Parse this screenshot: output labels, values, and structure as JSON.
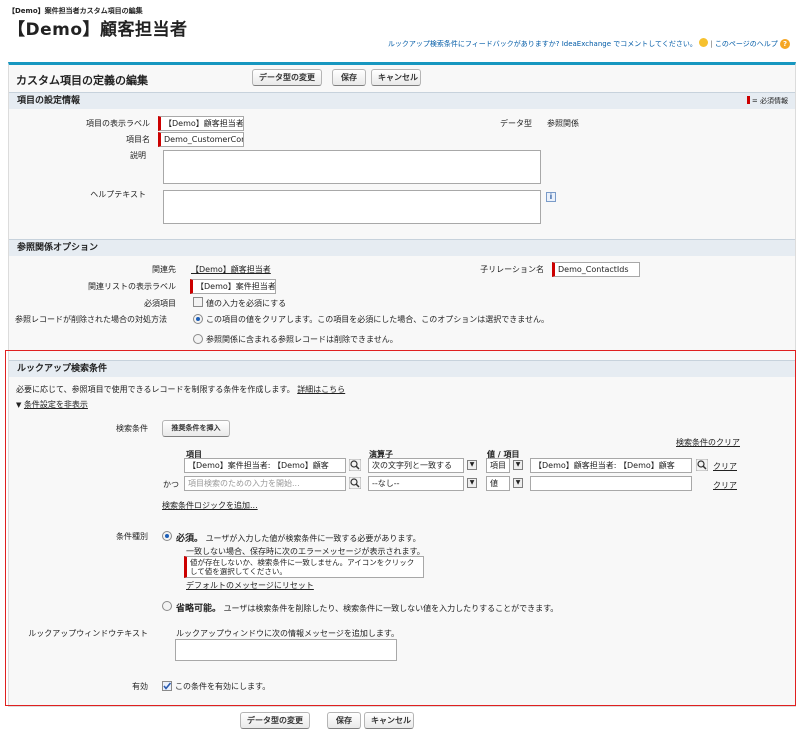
{
  "page": {
    "breadcrumb": "【Demo】案件担当者カスタム項目の編集",
    "title": "【Demo】顧客担当者",
    "feedback_text": "ルックアップ検索条件にフィードバックがありますか? IdeaExchange でコメントしてください。",
    "help_text": "このページのヘルプ",
    "separator": "|"
  },
  "editor": {
    "heading": "カスタム項目の定義の編集",
    "change_type_label": "データ型の変更",
    "save_label": "保存",
    "cancel_label": "キャンセル"
  },
  "field_settings": {
    "heading": "項目の設定情報",
    "required_legend": "= 必須情報",
    "display_label_label": "項目の表示ラベル",
    "display_label_value": "【Demo】顧客担当者",
    "field_name_label": "項目名",
    "field_name_value": "Demo_CustomerCor",
    "datatype_label": "データ型",
    "datatype_value": "参照関係",
    "description_label": "説明",
    "helptext_label": "ヘルプテキスト",
    "info_icon": "i"
  },
  "lookup_options": {
    "heading": "参照関係オプション",
    "related_to_label": "関連先",
    "related_to_value": "【Demo】顧客担当者",
    "child_rel_label": "子リレーション名",
    "child_rel_value": "Demo_ContactIds",
    "related_list_label": "関連リストの表示ラベル",
    "related_list_value": "【Demo】案件担当者",
    "required_label": "必須項目",
    "required_text": "値の入力を必須にする",
    "delete_label": "参照レコードが削除された場合の対処方法",
    "delete_opt1": "この項目の値をクリアします。この項目を必須にした場合、このオプションは選択できません。",
    "delete_opt2": "参照関係に含まれる参照レコードは削除できません。"
  },
  "lookup_filter": {
    "heading": "ルックアップ検索条件",
    "intro": "必要に応じて、参照項目で使用できるレコードを制限する条件を作成します。",
    "details_link": "詳細はこちら",
    "toggle_link": "条件設定を非表示",
    "criteria_label": "検索条件",
    "insert_button": "推奨条件を挿入",
    "clear_all_link": "検索条件のクリア",
    "col_field": "項目",
    "col_operator": "演算子",
    "col_value": "値 / 項目",
    "row1": {
      "field": "【Demo】案件担当者: 【Demo】顧客",
      "operator": "次の文字列と一致する",
      "type": "項目",
      "value": "【Demo】顧客担当者: 【Demo】顧客",
      "clear": "クリア"
    },
    "row2": {
      "prefix": "かつ",
      "field_placeholder": "項目検索のための入力を開始...",
      "operator": "--なし--",
      "type": "値",
      "value": "",
      "clear": "クリア"
    },
    "add_logic_link": "検索条件ロジックを追加...",
    "type_label": "条件種別",
    "required_strong": "必須。",
    "required_desc": "ユーザが入力した値が検索条件に一致する必要があります。",
    "error_intro": "一致しない場合、保存時に次のエラーメッセージが表示されます。",
    "error_message": "値が存在しないか、検索条件に一致しません。アイコンをクリックして値を選択してください。",
    "reset_link": "デフォルトのメッセージにリセット",
    "optional_strong": "省略可能。",
    "optional_desc": "ユーザは検索条件を削除したり、検索条件に一致しない値を入力したりすることができます。",
    "window_label": "ルックアップウィンドウテキスト",
    "window_desc": "ルックアップウィンドウに次の情報メッセージを追加します。",
    "active_label": "有効",
    "active_text": "この条件を有効にします。"
  },
  "colors": {
    "section_bg": "#e6ecf2",
    "link": "#015ba7",
    "required": "#cc0000",
    "highlight_border": "#e02020"
  }
}
